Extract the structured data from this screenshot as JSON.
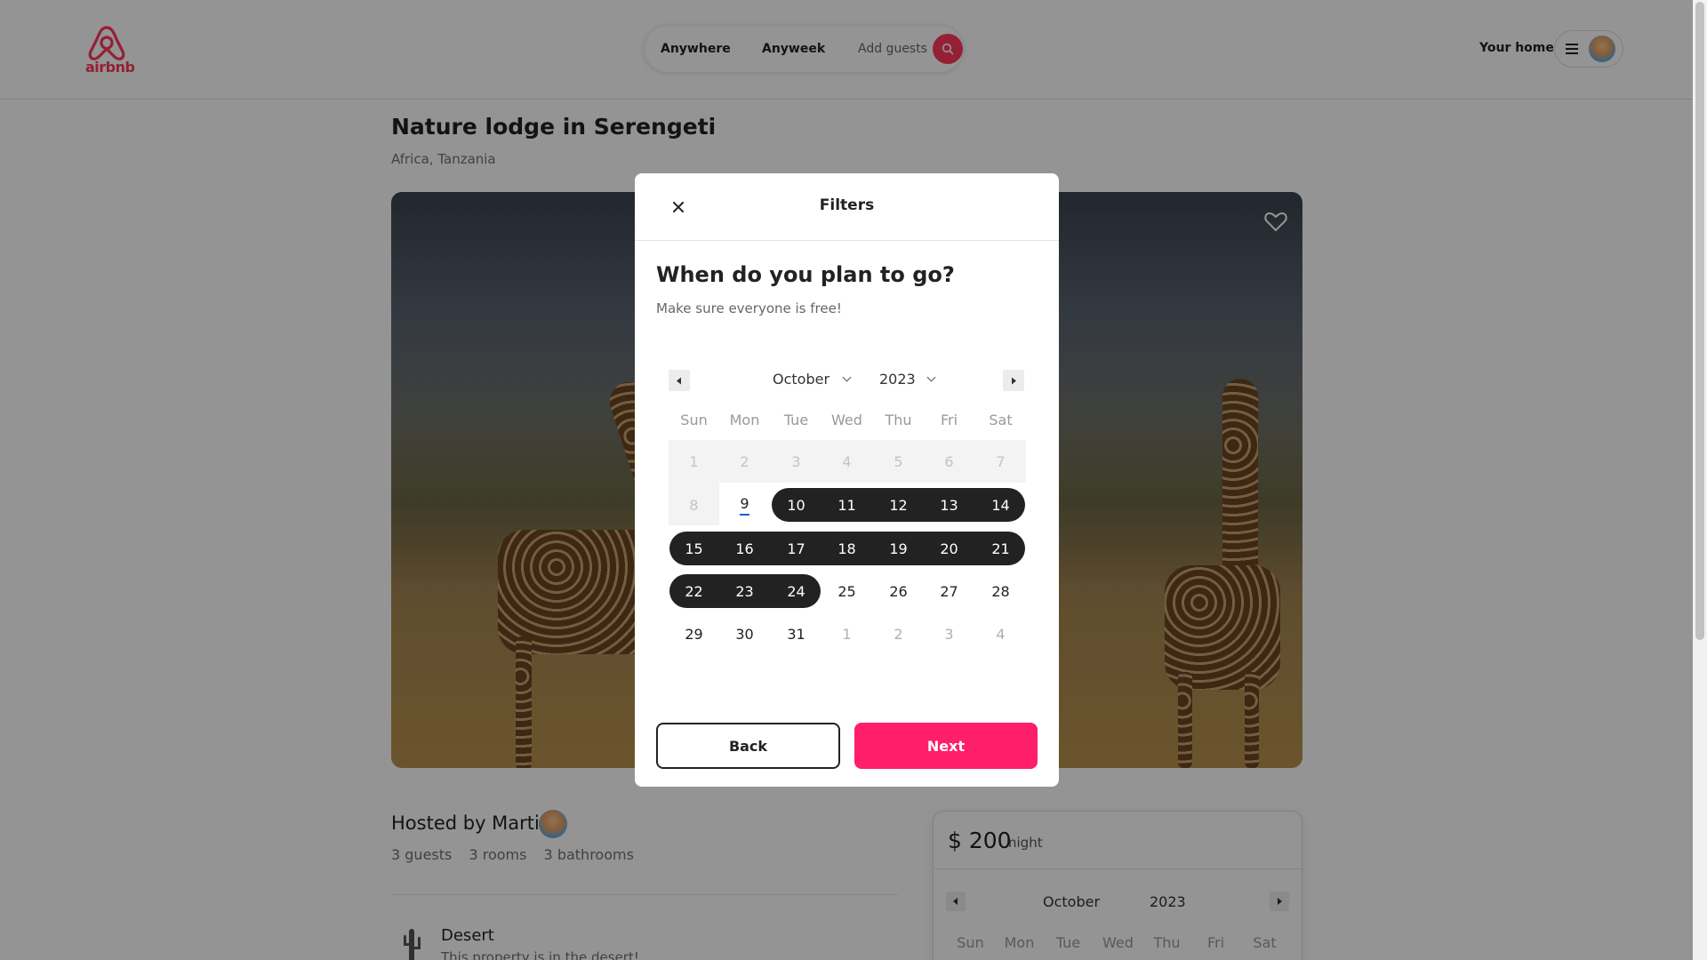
{
  "header": {
    "logo_text": "airbnb",
    "search": {
      "anywhere": "Anywhere",
      "anyweek": "Anyweek",
      "guests_placeholder": "Add guests"
    },
    "your_home": "Your home",
    "brand_color": "#ff385c"
  },
  "listing": {
    "title": "Nature lodge in Serengeti",
    "location": "Africa, Tanzania",
    "hosted_by": "Hosted by Martin",
    "facts": [
      "3 guests",
      "3 rooms",
      "3 bathrooms"
    ],
    "feature": {
      "title": "Desert",
      "description": "This property is in the desert!"
    }
  },
  "booking": {
    "price": "$ 200",
    "unit": "night",
    "month": "October",
    "year": "2023",
    "weekdays": [
      "Sun",
      "Mon",
      "Tue",
      "Wed",
      "Thu",
      "Fri",
      "Sat"
    ]
  },
  "modal": {
    "title": "Filters",
    "question": "When do you plan to go?",
    "subtitle": "Make sure everyone is free!",
    "calendar": {
      "month": "October",
      "year": "2023",
      "weekdays": [
        "Sun",
        "Mon",
        "Tue",
        "Wed",
        "Thu",
        "Fri",
        "Sat"
      ],
      "weeks": [
        [
          "1",
          "2",
          "3",
          "4",
          "5",
          "6",
          "7"
        ],
        [
          "8",
          "9",
          "10",
          "11",
          "12",
          "13",
          "14"
        ],
        [
          "15",
          "16",
          "17",
          "18",
          "19",
          "20",
          "21"
        ],
        [
          "22",
          "23",
          "24",
          "25",
          "26",
          "27",
          "28"
        ],
        [
          "29",
          "30",
          "31",
          "1",
          "2",
          "3",
          "4"
        ]
      ],
      "today": "9",
      "selected_range": {
        "start": "10",
        "end": "24"
      }
    },
    "back_label": "Back",
    "next_label": "Next",
    "accent_color": "#ff1e6a"
  }
}
